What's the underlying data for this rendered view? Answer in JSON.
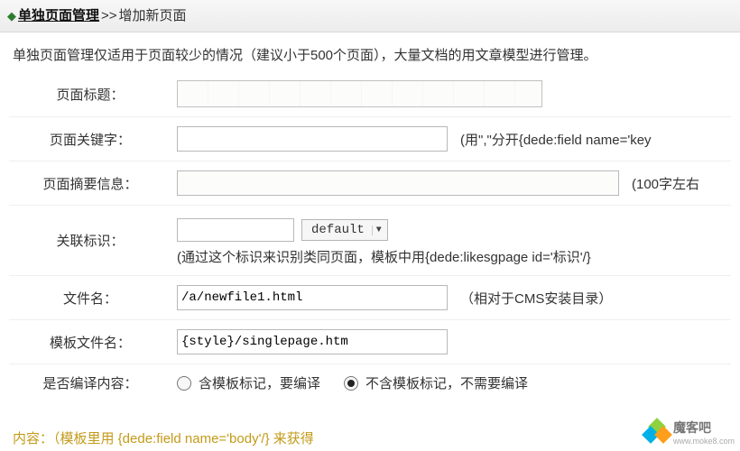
{
  "breadcrumb": {
    "link_label": "单独页面管理",
    "sep": ">>",
    "current": "增加新页面"
  },
  "intro_text": "单独页面管理仅适用于页面较少的情况（建议小于500个页面），大量文档的用文章模型进行管理。",
  "form": {
    "title": {
      "label": "页面标题：",
      "value": ""
    },
    "keywords": {
      "label": "页面关键字：",
      "value": "",
      "hint": "(用\",\"分开{dede:field name='key"
    },
    "summary": {
      "label": "页面摘要信息：",
      "value": "",
      "hint": "(100字左右"
    },
    "relmark": {
      "label": "关联标识：",
      "value": "",
      "select_value": "default",
      "subline": "(通过这个标识来识别类同页面，模板中用{dede:likesgpage id='标识'/}"
    },
    "filename": {
      "label": "文件名：",
      "value": "/a/newfile1.html",
      "hint": "（相对于CMS安装目录）"
    },
    "template": {
      "label": "模板文件名：",
      "value": "{style}/singlepage.htm"
    },
    "compile": {
      "label": "是否编译内容：",
      "opt_yes": "含模板标记，要编译",
      "opt_no": "不含模板标记，不需要编译",
      "selected": "no"
    }
  },
  "footer_partial": "内容：（模板里用 {dede:field name='body'/} 来获得",
  "watermark": {
    "name": "魔客吧",
    "url": "www.moke8.com"
  }
}
